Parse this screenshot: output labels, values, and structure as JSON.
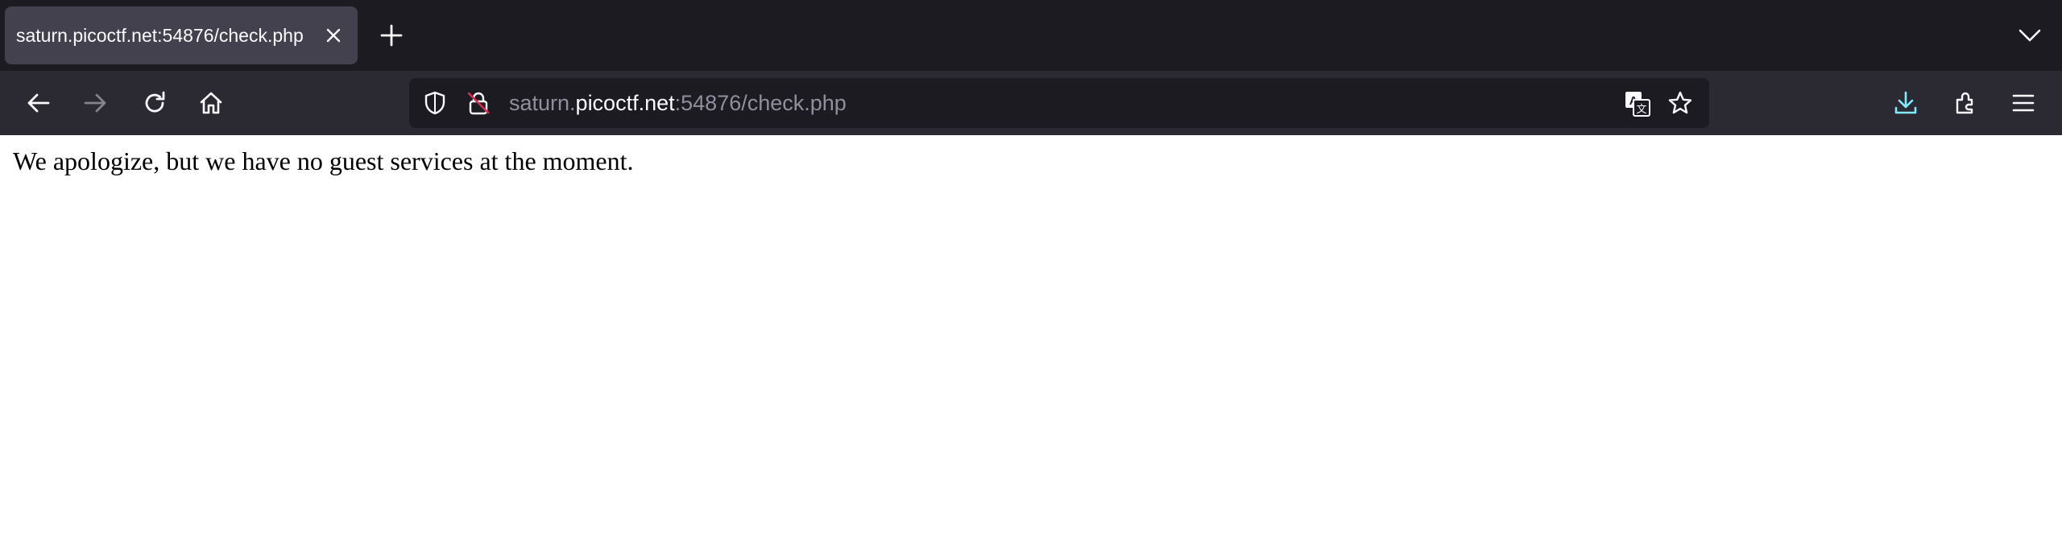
{
  "tab": {
    "title": "saturn.picoctf.net:54876/check.php"
  },
  "urlbar": {
    "prefix": "saturn.",
    "domain": "picoctf.net",
    "suffix": ":54876/check.php"
  },
  "page": {
    "message": "We apologize, but we have no guest services at the moment."
  },
  "colors": {
    "tabbar_bg": "#1c1b22",
    "active_tab_bg": "#42414d",
    "toolbar_bg": "#2b2a33",
    "urlbar_bg": "#1c1b22",
    "download_accent": "#54ffbd",
    "download_icon": "#80ebff",
    "insecure_strike": "#e22850"
  },
  "icons": [
    "close-icon",
    "new-tab-icon",
    "list-tabs-chevron-icon",
    "back-arrow-icon",
    "forward-arrow-icon",
    "reload-icon",
    "home-icon",
    "shield-icon",
    "insecure-lock-icon",
    "translate-icon",
    "bookmark-star-icon",
    "download-icon",
    "extensions-icon",
    "menu-icon"
  ]
}
